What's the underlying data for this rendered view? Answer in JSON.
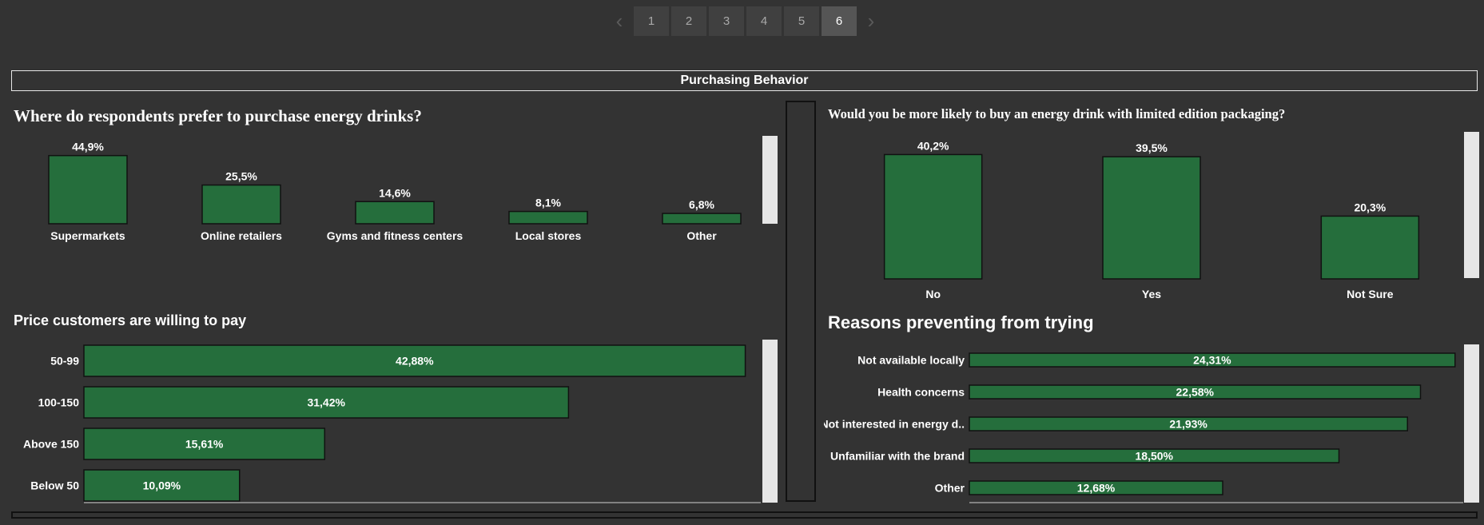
{
  "pager": {
    "prev_icon": "chevron-left-icon",
    "next_icon": "chevron-right-icon",
    "pages": [
      "1",
      "2",
      "3",
      "4",
      "5",
      "6"
    ],
    "active": "6"
  },
  "section_title": "Purchasing Behavior",
  "colors": {
    "bar": "#256e3c",
    "background": "#333333"
  },
  "chart_data": [
    {
      "id": "purchase_location",
      "type": "bar",
      "title": "Where do respondents prefer to purchase energy drinks?",
      "categories": [
        "Supermarkets",
        "Online retailers",
        "Gyms and fitness centers",
        "Local stores",
        "Other"
      ],
      "values": [
        44.9,
        25.5,
        14.6,
        8.1,
        6.8
      ],
      "value_labels": [
        "44,9%",
        "25,5%",
        "14,6%",
        "8,1%",
        "6,8%"
      ],
      "orientation": "vertical",
      "grid": false
    },
    {
      "id": "limited_edition",
      "type": "bar",
      "title": "Would you be more likely to buy an energy drink with limited edition packaging?",
      "categories": [
        "No",
        "Yes",
        "Not Sure"
      ],
      "values": [
        40.2,
        39.5,
        20.3
      ],
      "value_labels": [
        "40,2%",
        "39,5%",
        "20,3%"
      ],
      "orientation": "vertical",
      "grid": false
    },
    {
      "id": "price",
      "type": "bar",
      "title": "Price customers are willing to pay",
      "categories": [
        "50-99",
        "100-150",
        "Above 150",
        "Below 50"
      ],
      "values": [
        42.88,
        31.42,
        15.61,
        10.09
      ],
      "value_labels": [
        "42,88%",
        "31,42%",
        "15,61%",
        "10,09%"
      ],
      "orientation": "horizontal",
      "grid": false
    },
    {
      "id": "reasons",
      "type": "bar",
      "title": "Reasons preventing from trying",
      "categories": [
        "Not available locally",
        "Health concerns",
        "Not interested in energy d..",
        "Unfamiliar with the brand",
        "Other"
      ],
      "values": [
        24.31,
        22.58,
        21.93,
        18.5,
        12.68
      ],
      "value_labels": [
        "24,31%",
        "22,58%",
        "21,93%",
        "18,50%",
        "12,68%"
      ],
      "orientation": "horizontal",
      "grid": false
    }
  ]
}
